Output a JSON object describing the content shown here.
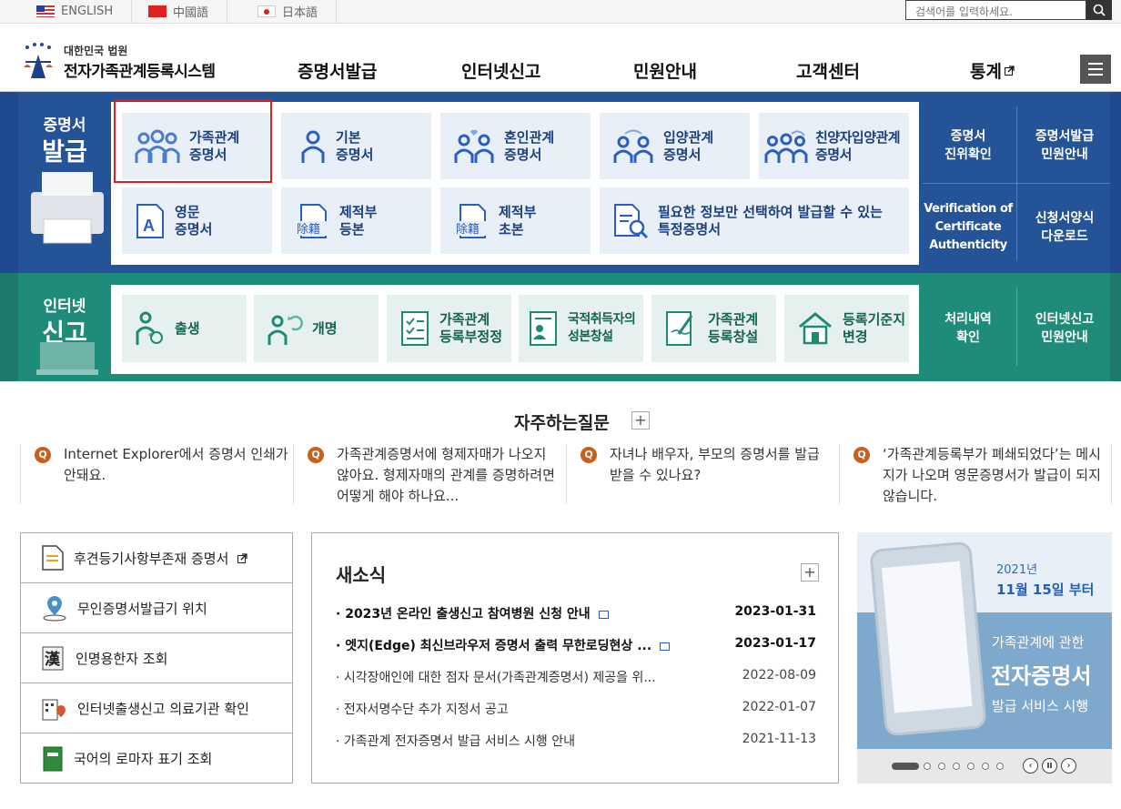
{
  "langs": [
    {
      "code": "us",
      "label": "ENGLISH"
    },
    {
      "code": "cn",
      "label": "中國語"
    },
    {
      "code": "jp",
      "label": "日本語"
    }
  ],
  "search": {
    "placeholder": "검색어를 입력하세요."
  },
  "logo": {
    "sub": "대한민국 법원",
    "main": "전자가족관계등록시스템"
  },
  "gnb": [
    "증명서발급",
    "인터넷신고",
    "민원안내",
    "고객센터",
    "통계"
  ],
  "cert": {
    "title_small": "증명서",
    "title_big": "발급",
    "tiles": [
      "가족관계\n증명서",
      "기본\n증명서",
      "혼인관계\n증명서",
      "입양관계\n증명서",
      "친양자입양관계\n증명서",
      "영문\n증명서",
      "제적부\n등본",
      "제적부\n초본",
      "필요한 정보만 선택하여 발급할 수 있는\n특정증명서"
    ],
    "side": [
      "증명서\n진위확인",
      "증명서발급\n민원안내",
      "Verification of\nCertificate\nAuthenticity",
      "신청서양식\n다운로드"
    ]
  },
  "report": {
    "title_small": "인터넷",
    "title_big": "신고",
    "tiles": [
      "출생",
      "개명",
      "가족관계\n등록부정정",
      "국적취득자의\n성본창설",
      "가족관계\n등록창설",
      "등록기준지\n변경"
    ],
    "side": [
      "처리내역\n확인",
      "인터넷신고\n민원안내"
    ]
  },
  "faq": {
    "title": "자주하는질문",
    "items": [
      "Internet Explorer에서 증명서 인쇄가 안돼요.",
      "가족관계증명서에 형제자매가 나오지 않아요. 형제자매의 관계를 증명하려면 어떻게 해야 하나요...",
      "자녀나 배우자, 부모의 증명서를 발급 받을 수 있나요?",
      "‘가족관계등록부가 폐쇄되었다’는 메시지가 나오며 영문증명서가 발급이 되지 않습니다."
    ]
  },
  "quick": [
    "후견등기사항부존재 증명서",
    "무인증명서발급기 위치",
    "인명용한자 조회",
    "인터넷출생신고 의료기관 확인",
    "국어의 로마자 표기 조회"
  ],
  "news": {
    "title": "새소식",
    "items": [
      {
        "title": "2023년 온라인 출생신고 참여병원 신청 안내",
        "date": "2023-01-31"
      },
      {
        "title": "엣지(Edge) 최신브라우저 증명서 출력 무한로딩현상 ...",
        "date": "2023-01-17"
      },
      {
        "title": "시각장애인에 대한 점자 문서(가족관계증명서) 제공을 위...",
        "date": "2022-08-09"
      },
      {
        "title": "전자서명수단 추가 지정서 공고",
        "date": "2022-01-07"
      },
      {
        "title": "가족관계 전자증명서 발급 서비스 시행 안내",
        "date": "2021-11-13"
      }
    ]
  },
  "banner": {
    "year": "2021년",
    "date": "11월 15일 부터",
    "line1": "가족관계에 관한",
    "line2": "전자증명서",
    "line3": "발급 서비스 시행"
  },
  "colors": {
    "cert_band": "#245398",
    "report_band": "#1f8c7a",
    "accent": "#c9601d",
    "highlight": "#e0201c"
  }
}
